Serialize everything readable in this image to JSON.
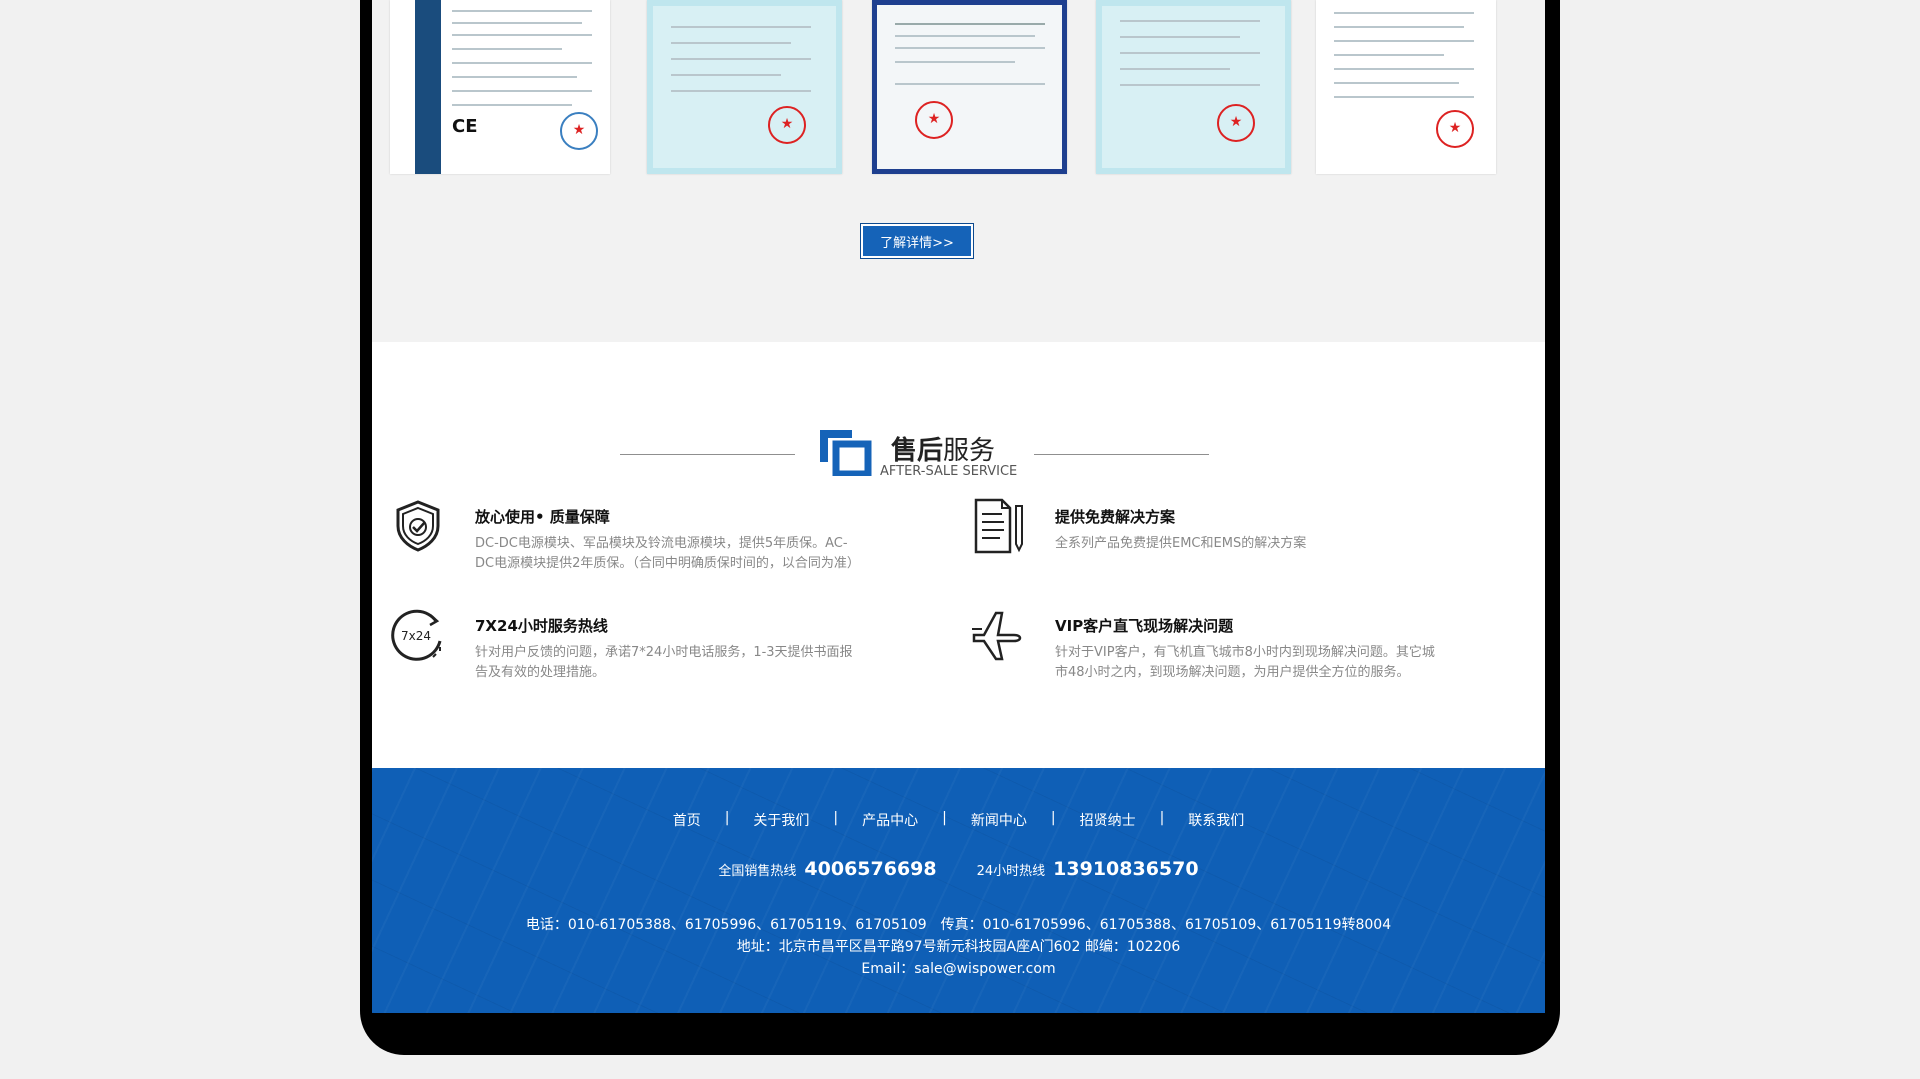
{
  "certificates": {
    "more_label": "了解详情>>"
  },
  "service": {
    "title_strong": "售后",
    "title_rest": "服务",
    "title_en": "AFTER-SALE SERVICE",
    "items": [
      {
        "title": "放心使用• 质量保障",
        "desc": "DC-DC电源模块、军品模块及铃流电源模块，提供5年质保。AC-DC电源模块提供2年质保。（合同中明确质保时间的，以合同为准）",
        "icon": "shield-check-icon"
      },
      {
        "title": "提供免费解决方案",
        "desc": "全系列产品免费提供EMC和EMS的解决方案",
        "icon": "document-pen-icon"
      },
      {
        "title": "7X24小时服务热线",
        "desc": "针对用户反馈的问题，承诺7*24小时电话服务，1-3天提供书面报告及有效的处理措施。",
        "icon": "clock-7x24-icon",
        "icon_text": "7x24"
      },
      {
        "title": "VIP客户直飞现场解决问题",
        "desc": "针对于VIP客户，有飞机直飞城市8小时内到现场解决问题。其它城市48小时之内，到现场解决问题，为用户提供全方位的服务。",
        "icon": "airplane-icon"
      }
    ]
  },
  "footer": {
    "nav": [
      "首页",
      "关于我们",
      "产品中心",
      "新闻中心",
      "招贤纳士",
      "联系我们"
    ],
    "nav_sep": "|",
    "hotline_label_1": "全国销售热线",
    "hotline_1": "4006576698",
    "hotline_label_2": "24小时热线",
    "hotline_2": "13910836570",
    "phone": "电话：010-61705388、61705996、61705119、61705109　传真：010-61705996、61705388、61705109、61705119转8004",
    "address": "地址：北京市昌平区昌平路97号新元科技园A座A门602  邮编：102206",
    "email": "Email：sale@wispower.com"
  },
  "colors": {
    "accent": "#1563b8",
    "footer_bg": "#0f5fb6"
  }
}
